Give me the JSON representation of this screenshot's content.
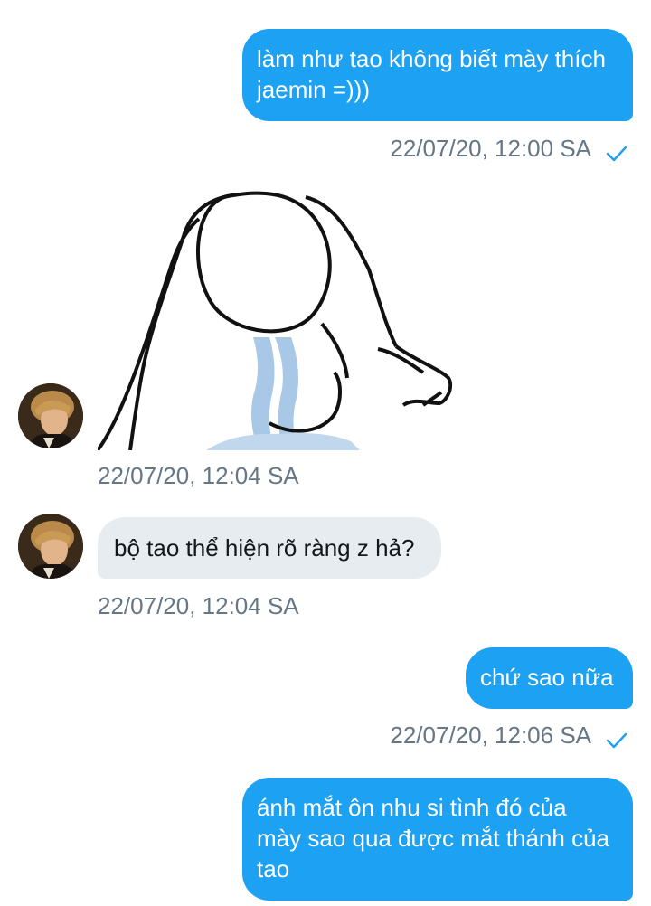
{
  "messages": [
    {
      "id": "m1",
      "direction": "outgoing",
      "text": "làm như tao không biết mày thích jaemin =)))",
      "time": "22/07/20, 12:00 SA",
      "status_icon": "checkmark-icon"
    },
    {
      "id": "m2",
      "direction": "incoming",
      "type": "image",
      "image_desc_icon": "crying-figure-sketch",
      "time": "22/07/20, 12:04 SA"
    },
    {
      "id": "m3",
      "direction": "incoming",
      "text": "bộ tao thể hiện rõ ràng z hả?",
      "time": "22/07/20, 12:04 SA"
    },
    {
      "id": "m4",
      "direction": "outgoing",
      "text": "chứ sao nữa",
      "time": "22/07/20, 12:06 SA",
      "status_icon": "checkmark-icon"
    },
    {
      "id": "m5",
      "direction": "outgoing",
      "text": "ánh mắt ôn nhu si tình đó của mày sao qua được mắt thánh của tao"
    }
  ],
  "colors": {
    "outgoing_bubble": "#1da1f2",
    "incoming_bubble": "#e6ecf0",
    "meta_text": "#657786",
    "check": "#1da1f2"
  }
}
